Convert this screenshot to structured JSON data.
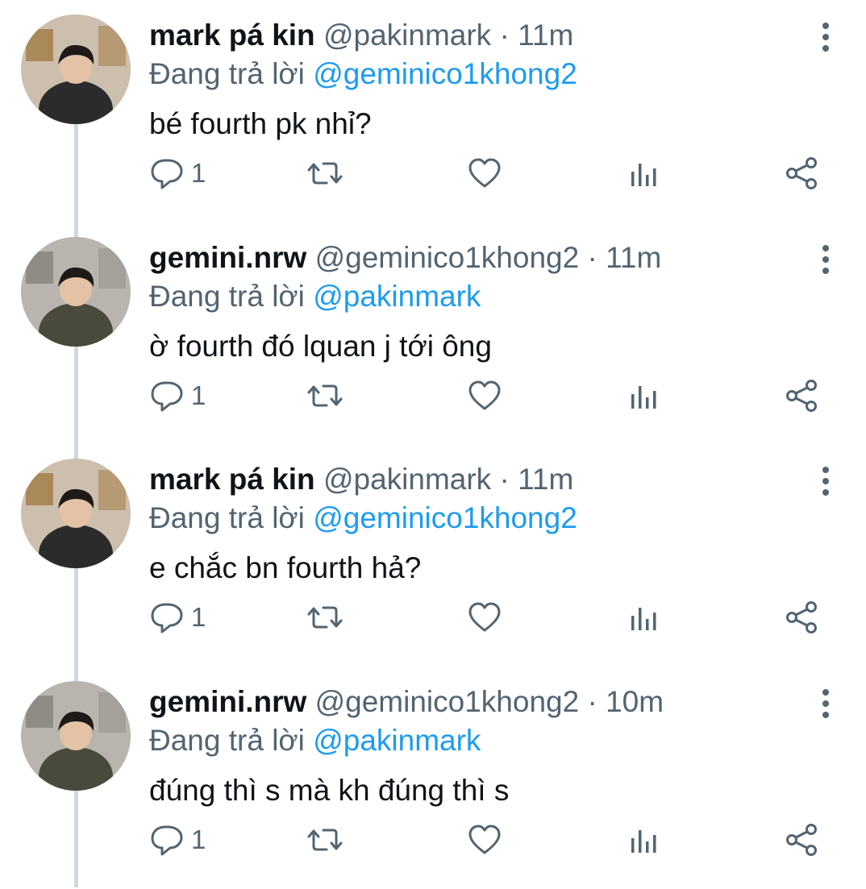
{
  "reply_prefix": "Đang trả lời",
  "colors": {
    "mention": "#1d9bf0",
    "muted": "#536471",
    "text": "#0f1419",
    "thread_line": "#cfd9de"
  },
  "icons": {
    "reply": "reply-icon",
    "retweet": "retweet-icon",
    "like": "heart-icon",
    "analytics": "analytics-icon",
    "share": "share-icon",
    "more": "more-vertical-icon"
  },
  "tweets": [
    {
      "name": "mark pá kin",
      "handle": "@pakinmark",
      "sep": "·",
      "time": "11m",
      "reply_to": "@geminico1khong2",
      "text": "bé fourth pk nhỉ?",
      "reply_count": "1"
    },
    {
      "name": "gemini.nrw",
      "handle": "@geminico1khong2",
      "sep": "·",
      "time": "11m",
      "reply_to": "@pakinmark",
      "text": "ờ fourth đó lquan j tới ông",
      "reply_count": "1"
    },
    {
      "name": "mark pá kin",
      "handle": "@pakinmark",
      "sep": "·",
      "time": "11m",
      "reply_to": "@geminico1khong2",
      "text": "e chắc bn fourth hả?",
      "reply_count": "1"
    },
    {
      "name": "gemini.nrw",
      "handle": "@geminico1khong2",
      "sep": "·",
      "time": "10m",
      "reply_to": "@pakinmark",
      "text": "đúng thì s mà kh đúng thì s",
      "reply_count": "1"
    }
  ]
}
